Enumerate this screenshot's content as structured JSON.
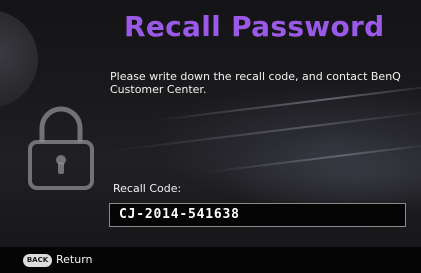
{
  "dialog": {
    "title": "Recall Password",
    "message": "Please write down the recall code, and contact BenQ Customer Center.",
    "lock_icon": "padlock-icon",
    "accent_color": "#9b59e8"
  },
  "recall_code": {
    "label": "Recall Code:",
    "value": "CJ-2014-541638"
  },
  "footer": {
    "back_button_icon_text": "BACK",
    "back_button_label": "Return"
  }
}
